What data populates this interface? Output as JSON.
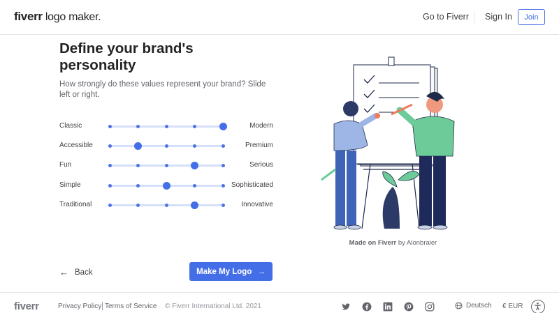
{
  "header": {
    "logo_brand": "fiverr",
    "logo_rest": " logo maker.",
    "nav_go_to_fiverr": "Go to Fiverr",
    "nav_sign_in": "Sign In",
    "join_label": "Join"
  },
  "main": {
    "title": "Define your brand's personality",
    "subtitle": "How strongly do these values represent your brand? Slide left or right.",
    "sliders": [
      {
        "left": "Classic",
        "right": "Modern",
        "value_step": 5,
        "steps": 5
      },
      {
        "left": "Accessible",
        "right": "Premium",
        "value_step": 2,
        "steps": 5
      },
      {
        "left": "Fun",
        "right": "Serious",
        "value_step": 4,
        "steps": 5
      },
      {
        "left": "Simple",
        "right": "Sophisticated",
        "value_step": 3,
        "steps": 5
      },
      {
        "left": "Traditional",
        "right": "Innovative",
        "value_step": 4,
        "steps": 5
      }
    ],
    "back_label": "Back",
    "primary_label": "Make My Logo",
    "credit_prefix": "Made on Fiverr",
    "credit_suffix": " by Alonbraier"
  },
  "footer": {
    "logo": "fiverr",
    "privacy": "Privacy Policy",
    "terms": "Terms of Service",
    "copyright": "© Fiverr International Ltd. 2021",
    "language": "Deutsch",
    "currency": "€ EUR",
    "social_icons": [
      "twitter-icon",
      "facebook-icon",
      "linkedin-icon",
      "pinterest-icon",
      "instagram-icon"
    ]
  },
  "colors": {
    "accent": "#446ee7",
    "track": "#d6e0fb",
    "text_dark": "#222325",
    "text": "#404145"
  }
}
